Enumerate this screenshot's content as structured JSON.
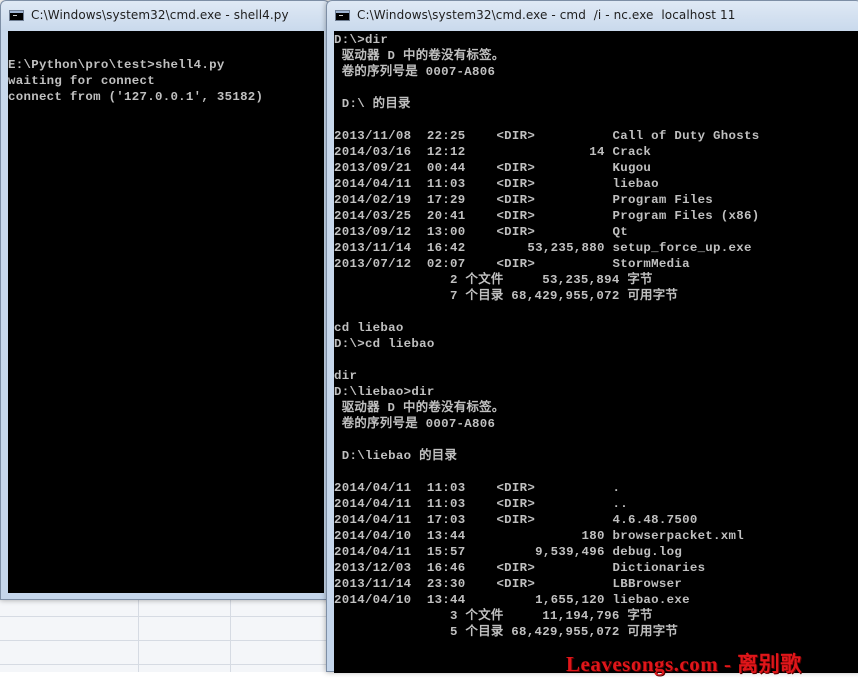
{
  "left_window": {
    "title": "C:\\Windows\\system32\\cmd.exe - shell4.py",
    "lines": [
      "",
      "E:\\Python\\pro\\test>shell4.py",
      "waiting for connect",
      "connect from ('127.0.0.1', 35182)"
    ]
  },
  "right_window": {
    "title": "C:\\Windows\\system32\\cmd.exe - cmd  /i - nc.exe  localhost 11",
    "lines": [
      "D:\\>dir",
      " 驱动器 D 中的卷没有标签。",
      " 卷的序列号是 0007-A806",
      "",
      " D:\\ 的目录",
      "",
      "2013/11/08  22:25    <DIR>          Call of Duty Ghosts",
      "2014/03/16  12:12                14 Crack",
      "2013/09/21  00:44    <DIR>          Kugou",
      "2014/04/11  11:03    <DIR>          liebao",
      "2014/02/19  17:29    <DIR>          Program Files",
      "2014/03/25  20:41    <DIR>          Program Files (x86)",
      "2013/09/12  13:00    <DIR>          Qt",
      "2013/11/14  16:42        53,235,880 setup_force_up.exe",
      "2013/07/12  02:07    <DIR>          StormMedia",
      "               2 个文件     53,235,894 字节",
      "               7 个目录 68,429,955,072 可用字节",
      "",
      "cd liebao",
      "D:\\>cd liebao",
      "",
      "dir",
      "D:\\liebao>dir",
      " 驱动器 D 中的卷没有标签。",
      " 卷的序列号是 0007-A806",
      "",
      " D:\\liebao 的目录",
      "",
      "2014/04/11  11:03    <DIR>          .",
      "2014/04/11  11:03    <DIR>          ..",
      "2014/04/11  17:03    <DIR>          4.6.48.7500",
      "2014/04/10  13:44               180 browserpacket.xml",
      "2014/04/11  15:57         9,539,496 debug.log",
      "2013/12/03  16:46    <DIR>          Dictionaries",
      "2013/11/14  23:30    <DIR>          LBBrowser",
      "2014/04/10  13:44         1,655,120 liebao.exe",
      "               3 个文件     11,194,796 字节",
      "               5 个目录 68,429,955,072 可用字节"
    ]
  },
  "watermark": "Leavesongs.com - 离别歌",
  "colors": {
    "console_bg": "#000000",
    "console_fg": "#c0c0c0",
    "watermark": "#e0161a"
  },
  "icons": {
    "cmd_window_icon": "cmd-icon"
  }
}
